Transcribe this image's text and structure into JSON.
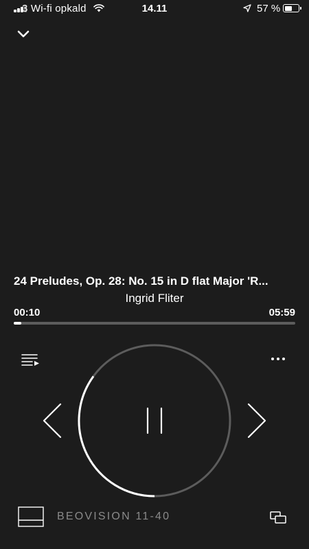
{
  "status_bar": {
    "carrier": "3 Wi-fi opkald",
    "time": "14.11",
    "battery_percent": "57 %",
    "battery_level": 0.57,
    "signal_bars_active": 3,
    "signal_bars_total": 4
  },
  "track": {
    "title": "24 Preludes, Op. 28: No. 15 in D flat Major 'R...",
    "artist": "Ingrid Fliter"
  },
  "progress": {
    "elapsed": "00:10",
    "total": "05:59",
    "fraction": 0.028
  },
  "volume": {
    "fraction": 0.35
  },
  "device": {
    "name": "BEOVISION 11-40"
  },
  "colors": {
    "background": "#1c1c1c",
    "foreground": "#ffffff",
    "track_inactive": "#5c5c5c",
    "device_label": "#8a8a8a"
  },
  "icons": {
    "collapse": "chevron-down-icon",
    "queue": "queue-list-icon",
    "more": "more-dots-icon",
    "previous": "chevron-left-icon",
    "next": "chevron-right-icon",
    "pause": "pause-icon",
    "device": "tv-icon",
    "multiroom": "multiroom-icon",
    "wifi": "wifi-icon",
    "location": "location-arrow-icon",
    "battery": "battery-icon",
    "signal": "signal-bars-icon"
  }
}
